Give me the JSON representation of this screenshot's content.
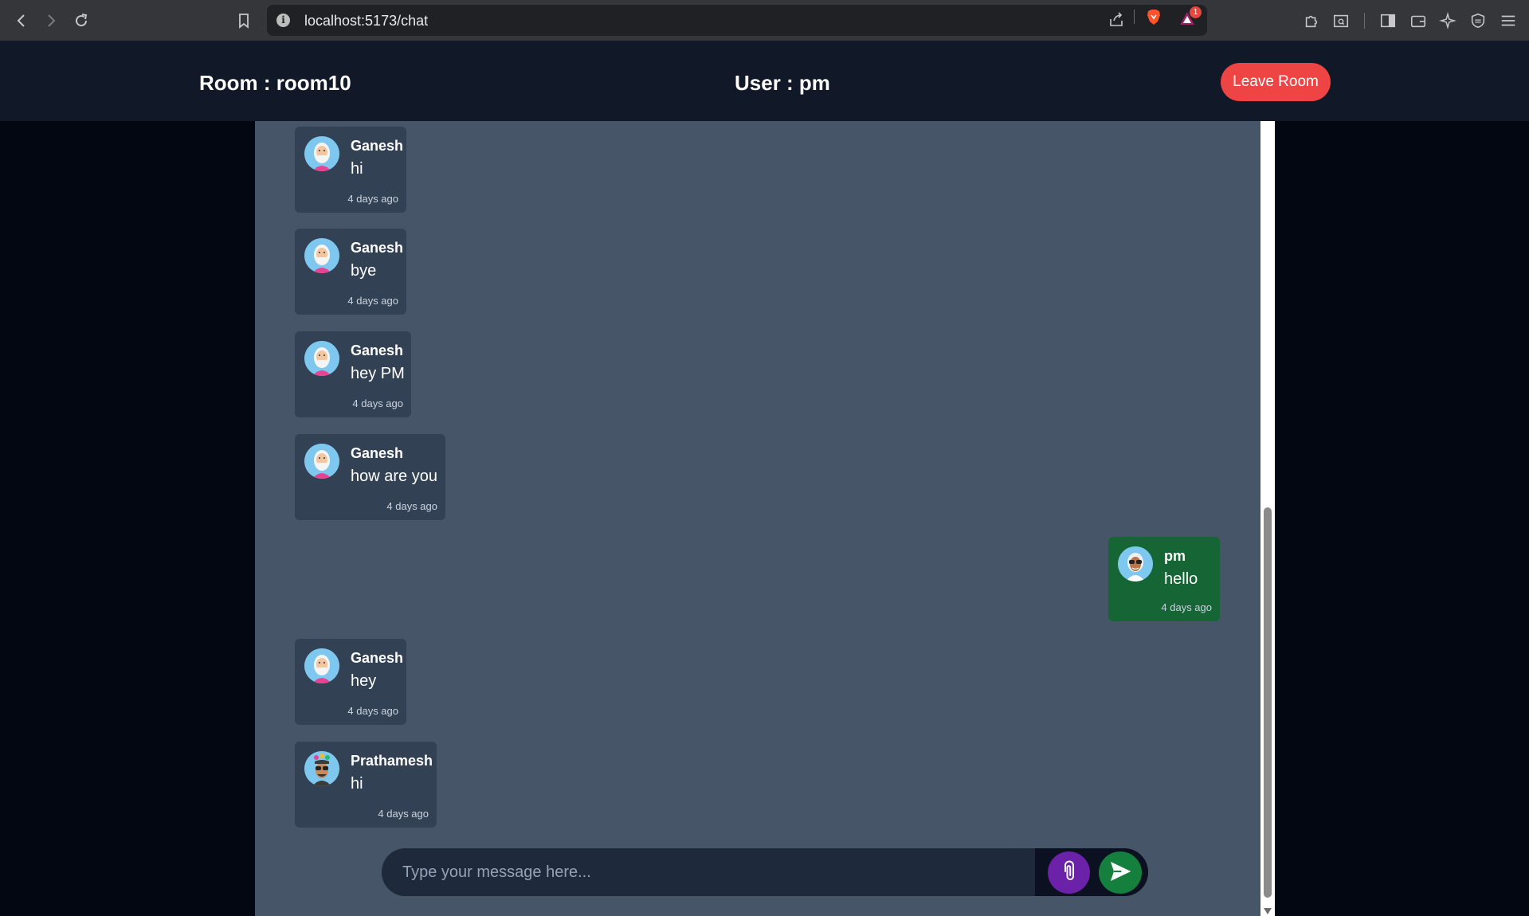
{
  "browser": {
    "url": "localhost:5173/chat",
    "notification_count": "1"
  },
  "header": {
    "room": "Room : room10",
    "user": "User : pm",
    "leave_label": "Leave Room"
  },
  "messages": [
    {
      "name": "Ganesh",
      "text": "hi",
      "time": "4 days ago",
      "mine": false,
      "avatar": "white-hair-avatar-icon"
    },
    {
      "name": "Ganesh",
      "text": "bye",
      "time": "4 days ago",
      "mine": false,
      "avatar": "white-hair-avatar-icon"
    },
    {
      "name": "Ganesh",
      "text": "hey PM",
      "time": "4 days ago",
      "mine": false,
      "avatar": "white-hair-avatar-icon"
    },
    {
      "name": "Ganesh",
      "text": "how are you",
      "time": "4 days ago",
      "mine": false,
      "avatar": "white-hair-avatar-icon"
    },
    {
      "name": "pm",
      "text": "hello",
      "time": "4 days ago",
      "mine": true,
      "avatar": "sunglasses-avatar-icon"
    },
    {
      "name": "Ganesh",
      "text": "hey",
      "time": "4 days ago",
      "mine": false,
      "avatar": "white-hair-avatar-icon"
    },
    {
      "name": "Prathamesh",
      "text": "hi",
      "time": "4 days ago",
      "mine": false,
      "avatar": "flower-hat-avatar-icon"
    }
  ],
  "composer": {
    "placeholder": "Type your message here..."
  },
  "colors": {
    "accent_leave": "#ef4444",
    "mine_bubble": "#166534",
    "other_bubble": "#334155",
    "attach": "#6b21a8",
    "send": "#15803d"
  }
}
